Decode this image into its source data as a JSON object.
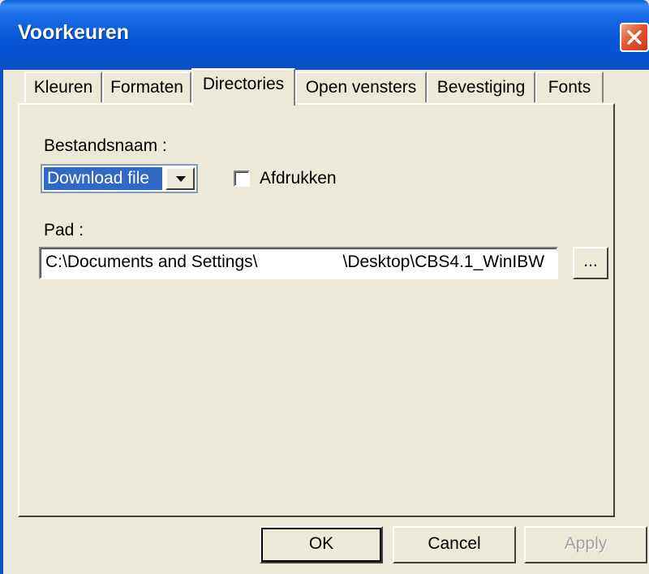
{
  "window": {
    "title": "Voorkeuren"
  },
  "tabs": [
    {
      "label": "Kleuren"
    },
    {
      "label": "Formaten"
    },
    {
      "label": "Directories"
    },
    {
      "label": "Open vensters"
    },
    {
      "label": "Bevestiging"
    },
    {
      "label": "Fonts"
    }
  ],
  "active_tab": "Directories",
  "directories": {
    "filename_label": "Bestandsnaam :",
    "filename_selected": "Download file",
    "print_checkbox_label": "Afdrukken",
    "print_checked": false,
    "path_label": "Pad :",
    "path_value": "C:\\Documents and Settings\\                  \\Desktop\\CBS4.1_WinIBW",
    "browse_label": "..."
  },
  "buttons": {
    "ok": "OK",
    "cancel": "Cancel",
    "apply": "Apply"
  },
  "colors": {
    "titlebar": "#0a5fde",
    "selection": "#316ac5",
    "dialog_bg": "#ece9d8",
    "close_button": "#e2582f"
  }
}
